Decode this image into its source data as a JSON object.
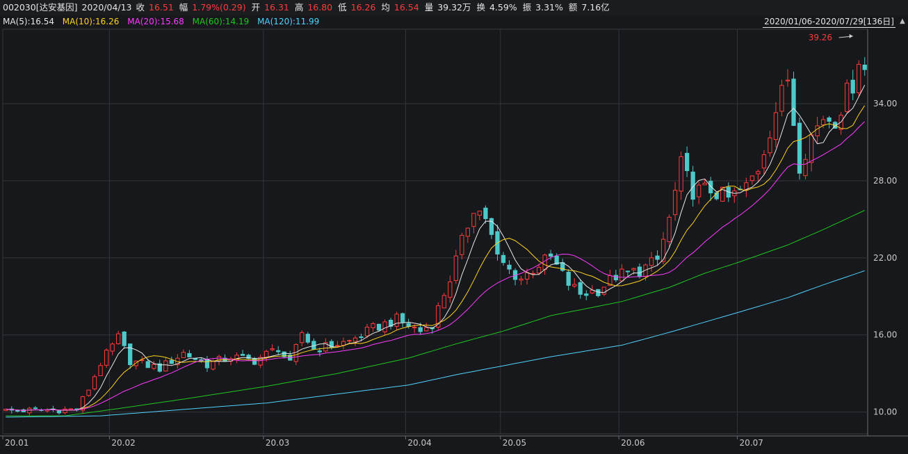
{
  "info": {
    "code": "002030[达安基因]",
    "date": "2020/04/13",
    "close_label": "收",
    "close_value": "16.51",
    "change_label": "幅",
    "change_value": "1.79%(0.29)",
    "open_label": "开",
    "open_value": "16.31",
    "high_label": "高",
    "high_value": "16.80",
    "low_label": "低",
    "low_value": "16.26",
    "avg_label": "均",
    "avg_value": "16.54",
    "volume_label": "量",
    "volume_value": "39.32万",
    "turnover_label": "换",
    "turnover_value": "4.59%",
    "amplitude_label": "振",
    "amplitude_value": "3.31%",
    "amount_label": "额",
    "amount_value": "7.16亿"
  },
  "ma_legend": [
    {
      "label": "MA(5):16.54",
      "color": "#e8e8e8"
    },
    {
      "label": "MA(10):16.26",
      "color": "#ffd21e"
    },
    {
      "label": "MA(20):15.68",
      "color": "#ff3cff"
    },
    {
      "label": "MA(60):14.19",
      "color": "#1ec81e"
    },
    {
      "label": "MA(120):11.99",
      "color": "#50d2ff"
    }
  ],
  "range_text": "2020/01/06-2020/07/29[136日]",
  "range_icon": "scroll-arrows-icon",
  "chart_data": {
    "type": "candlestick",
    "ylim": [
      8.3,
      39.8
    ],
    "y_ticks": [
      "34.00",
      "28.00",
      "22.00",
      "16.00",
      "10.00"
    ],
    "y_tick_values": [
      34,
      28,
      22,
      16,
      10
    ],
    "x_ticks": [
      "20.01",
      "20.02",
      "20.03",
      "20.04",
      "20.05",
      "20.06",
      "20.07"
    ],
    "x_tick_index": [
      0,
      18,
      44,
      68,
      84,
      104,
      124
    ],
    "max_annotation": "39.26",
    "max_value": 39.26,
    "candle_count": 136,
    "up_color": "#ff3b3b",
    "down_color": "#4ec9c9",
    "grid": true,
    "legend_placement": "top-left",
    "close_anchors": [
      [
        0,
        10.1
      ],
      [
        12,
        10.2
      ],
      [
        14,
        11.8
      ],
      [
        16,
        13.8
      ],
      [
        19,
        15.8
      ],
      [
        21,
        14.0
      ],
      [
        26,
        13.4
      ],
      [
        30,
        14.6
      ],
      [
        34,
        13.7
      ],
      [
        38,
        14.3
      ],
      [
        42,
        14.0
      ],
      [
        46,
        15.0
      ],
      [
        48,
        13.7
      ],
      [
        50,
        16.2
      ],
      [
        52,
        14.9
      ],
      [
        58,
        15.5
      ],
      [
        62,
        16.5
      ],
      [
        66,
        17.2
      ],
      [
        70,
        16.3
      ],
      [
        72,
        16.9
      ],
      [
        75,
        20.4
      ],
      [
        77,
        23.2
      ],
      [
        79,
        26.0
      ],
      [
        81,
        25.2
      ],
      [
        83,
        22.0
      ],
      [
        85,
        21.0
      ],
      [
        87,
        20.4
      ],
      [
        90,
        21.5
      ],
      [
        92,
        22.0
      ],
      [
        95,
        20.0
      ],
      [
        97,
        19.2
      ],
      [
        100,
        19.5
      ],
      [
        103,
        20.6
      ],
      [
        107,
        21.0
      ],
      [
        110,
        21.8
      ],
      [
        112,
        25.0
      ],
      [
        114,
        29.2
      ],
      [
        116,
        27.2
      ],
      [
        119,
        27.3
      ],
      [
        122,
        26.6
      ],
      [
        125,
        27.5
      ],
      [
        127,
        29.0
      ],
      [
        130,
        33.5
      ],
      [
        132,
        36.0
      ],
      [
        134,
        29.3
      ],
      [
        136,
        31.5
      ],
      [
        138,
        33.0
      ],
      [
        140,
        32.8
      ],
      [
        142,
        34.8
      ],
      [
        143,
        35.6
      ],
      [
        144,
        37.6
      ],
      [
        145,
        36.6
      ]
    ],
    "series": [
      {
        "name": "MA(5)",
        "color": "#e8e8e8",
        "period": 5
      },
      {
        "name": "MA(10)",
        "color": "#ffd21e",
        "period": 10
      },
      {
        "name": "MA(20)",
        "color": "#ff3cff",
        "period": 20
      },
      {
        "name": "MA(60)",
        "color": "#1ec81e",
        "anchors": [
          [
            0,
            9.7
          ],
          [
            10,
            9.7
          ],
          [
            18,
            10.2
          ],
          [
            30,
            11.0
          ],
          [
            44,
            12.0
          ],
          [
            56,
            13.0
          ],
          [
            68,
            14.2
          ],
          [
            76,
            15.3
          ],
          [
            84,
            16.3
          ],
          [
            92,
            17.5
          ],
          [
            104,
            18.6
          ],
          [
            112,
            19.7
          ],
          [
            118,
            20.8
          ],
          [
            124,
            21.7
          ],
          [
            132,
            23.0
          ],
          [
            138,
            24.2
          ],
          [
            145,
            25.7
          ]
        ]
      },
      {
        "name": "MA(120)",
        "color": "#50d2ff",
        "anchors": [
          [
            0,
            9.6
          ],
          [
            16,
            9.7
          ],
          [
            30,
            10.2
          ],
          [
            44,
            10.7
          ],
          [
            56,
            11.4
          ],
          [
            68,
            12.1
          ],
          [
            76,
            12.9
          ],
          [
            84,
            13.6
          ],
          [
            92,
            14.3
          ],
          [
            104,
            15.2
          ],
          [
            112,
            16.2
          ],
          [
            118,
            17.0
          ],
          [
            124,
            17.8
          ],
          [
            132,
            18.9
          ],
          [
            138,
            19.9
          ],
          [
            145,
            21.0
          ]
        ]
      }
    ]
  }
}
